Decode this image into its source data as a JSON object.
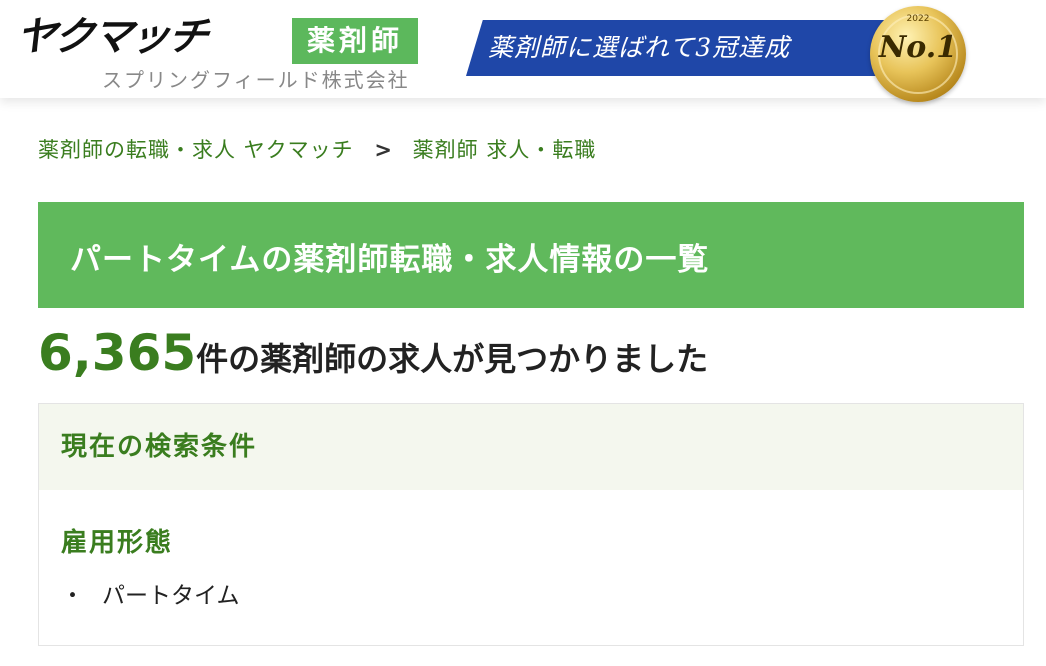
{
  "header": {
    "logo": {
      "name": "ヤクマッチ",
      "badge": "薬剤師",
      "company": "スプリングフィールド株式会社"
    },
    "banner": {
      "text": "薬剤師に選ばれて3冠達成",
      "medal_text": "No.1",
      "medal_year": "2022"
    }
  },
  "breadcrumb": {
    "items": [
      {
        "label": "薬剤師の転職・求人 ヤクマッチ"
      },
      {
        "label": "薬剤師 求人・転職"
      }
    ],
    "separator": ">"
  },
  "page": {
    "title": "パートタイムの薬剤師転職・求人情報の一覧",
    "result_count": "6,365",
    "result_suffix": "件の薬剤師の求人が見つかりました"
  },
  "search_conditions": {
    "heading": "現在の検索条件",
    "groups": [
      {
        "label": "雇用形態",
        "bullet": "・",
        "values": [
          "パートタイム"
        ]
      }
    ]
  },
  "colors": {
    "brand_green": "#60b95c",
    "text_green": "#3a7d1f",
    "banner_blue": "#1f47a8",
    "conditions_bg": "#f4f7ee"
  }
}
